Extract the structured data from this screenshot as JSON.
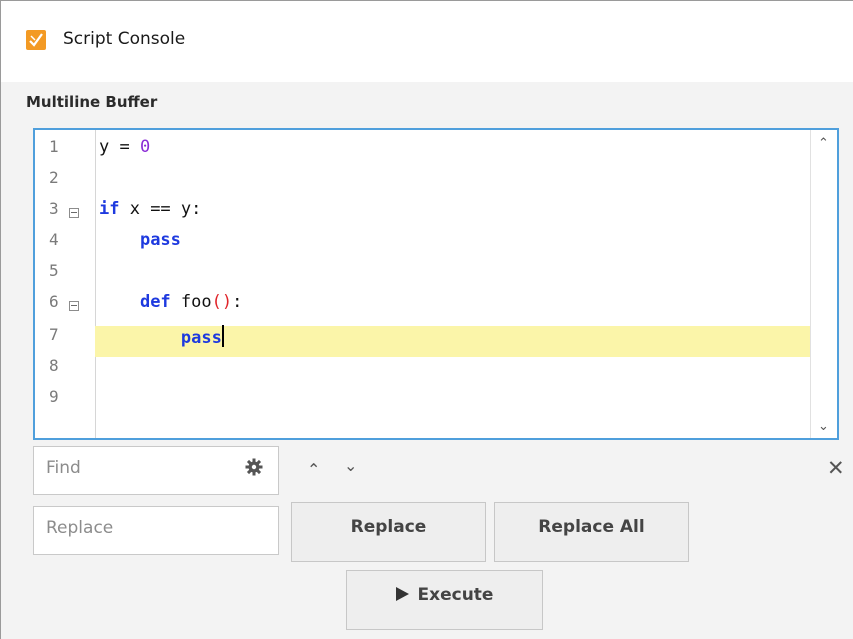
{
  "window": {
    "title": "Script Console",
    "icon": "script-console-app-icon"
  },
  "buffer": {
    "label": "Multiline Buffer",
    "lines": [
      {
        "num": "1",
        "text": "y = 0"
      },
      {
        "num": "2",
        "text": ""
      },
      {
        "num": "3",
        "text": "if x == y:",
        "fold": true
      },
      {
        "num": "4",
        "text": "    pass"
      },
      {
        "num": "5",
        "text": ""
      },
      {
        "num": "6",
        "text": "    def foo():",
        "fold": true
      },
      {
        "num": "7",
        "text": "        pass",
        "highlighted": true
      },
      {
        "num": "8",
        "text": ""
      },
      {
        "num": "9",
        "text": ""
      }
    ],
    "highlight_color": "#fbf5a9",
    "border_color": "#4f9fdc"
  },
  "find": {
    "placeholder": "Find",
    "options_icon": "gear-icon"
  },
  "replace": {
    "placeholder": "Replace",
    "replace_label": "Replace",
    "replace_all_label": "Replace All"
  },
  "execute": {
    "label": "Execute",
    "icon": "play-icon"
  },
  "colors": {
    "keyword": "#1e3adf",
    "number": "#8a2bd6",
    "paren": "#e0242a",
    "accent": "#f39a24"
  }
}
